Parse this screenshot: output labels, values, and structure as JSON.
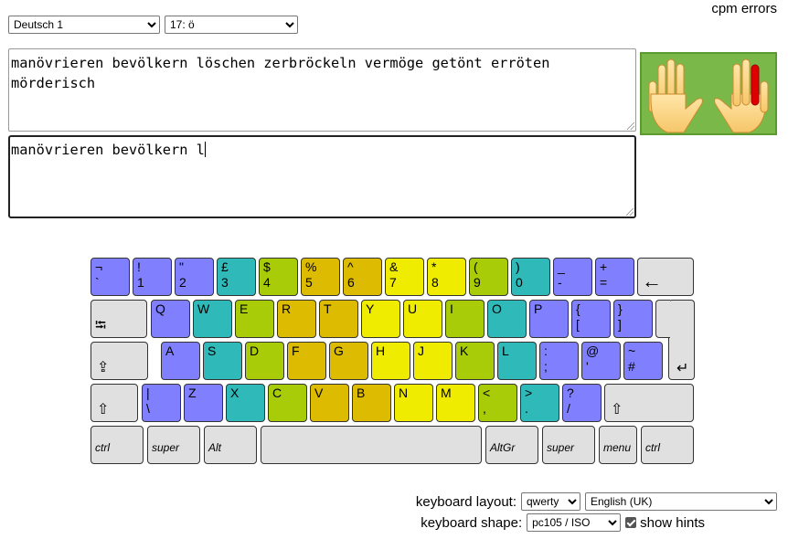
{
  "lesson": {
    "selected": "Deutsch 1"
  },
  "level": {
    "selected": "17: ö"
  },
  "stats": {
    "text": "cpm errors"
  },
  "source_text": "manövrieren bevölkern löschen zerbröckeln vermöge getönt erröten mörderisch",
  "typed_text": "manövrieren bevölkern l",
  "colors": {
    "pinky": "#8080ff",
    "ring": "#30b9b9",
    "middle": "#a8cc08",
    "index_left": "#ddbb00",
    "index_right": "#f0ec00",
    "thumb": "#e0e0e0",
    "hands_bg": "#7bb84a",
    "highlight_finger": "#e00000"
  },
  "keyboard": {
    "row1": [
      {
        "top": "¬",
        "bottom": "`",
        "color": "pinky"
      },
      {
        "top": "!",
        "bottom": "1",
        "color": "pinky"
      },
      {
        "top": "\"",
        "bottom": "2",
        "color": "pinky"
      },
      {
        "top": "£",
        "bottom": "3",
        "color": "ring"
      },
      {
        "top": "$",
        "bottom": "4",
        "color": "middle"
      },
      {
        "top": "%",
        "bottom": "5",
        "color": "index_left"
      },
      {
        "top": "^",
        "bottom": "6",
        "color": "index_left"
      },
      {
        "top": "&",
        "bottom": "7",
        "color": "index_right"
      },
      {
        "top": "*",
        "bottom": "8",
        "color": "index_right"
      },
      {
        "top": "(",
        "bottom": "9",
        "color": "middle"
      },
      {
        "top": ")",
        "bottom": "0",
        "color": "ring"
      },
      {
        "top": "_",
        "bottom": "-",
        "color": "pinky"
      },
      {
        "top": "+",
        "bottom": "=",
        "color": "pinky"
      },
      {
        "symbol": "←",
        "name": "backspace",
        "color": "thumb"
      }
    ],
    "row2": [
      {
        "symbol": "⭾",
        "name": "tab",
        "color": "thumb"
      },
      {
        "top": "Q",
        "color": "pinky"
      },
      {
        "top": "W",
        "color": "ring"
      },
      {
        "top": "E",
        "color": "middle"
      },
      {
        "top": "R",
        "color": "index_left"
      },
      {
        "top": "T",
        "color": "index_left"
      },
      {
        "top": "Y",
        "color": "index_right"
      },
      {
        "top": "U",
        "color": "index_right"
      },
      {
        "top": "I",
        "color": "middle"
      },
      {
        "top": "O",
        "color": "ring"
      },
      {
        "top": "P",
        "color": "pinky"
      },
      {
        "top": "{",
        "bottom": "[",
        "color": "pinky"
      },
      {
        "top": "}",
        "bottom": "]",
        "color": "pinky"
      }
    ],
    "row3": [
      {
        "symbol": "⇪",
        "name": "caps-lock",
        "color": "thumb"
      },
      {
        "top": "A",
        "color": "pinky"
      },
      {
        "top": "S",
        "color": "ring"
      },
      {
        "top": "D",
        "color": "middle"
      },
      {
        "top": "F",
        "color": "index_left"
      },
      {
        "top": "G",
        "color": "index_left"
      },
      {
        "top": "H",
        "color": "index_right"
      },
      {
        "top": "J",
        "color": "index_right"
      },
      {
        "top": "K",
        "color": "middle"
      },
      {
        "top": "L",
        "color": "ring"
      },
      {
        "top": ":",
        "bottom": ";",
        "color": "pinky"
      },
      {
        "top": "@",
        "bottom": "'",
        "color": "pinky"
      },
      {
        "top": "~",
        "bottom": "#",
        "color": "pinky"
      },
      {
        "symbol": "↵",
        "name": "enter",
        "color": "thumb"
      }
    ],
    "row4": [
      {
        "symbol": "⇧",
        "name": "left-shift",
        "color": "thumb"
      },
      {
        "top": "|",
        "bottom": "\\",
        "color": "pinky"
      },
      {
        "top": "Z",
        "color": "pinky"
      },
      {
        "top": "X",
        "color": "ring"
      },
      {
        "top": "C",
        "color": "middle"
      },
      {
        "top": "V",
        "color": "index_left"
      },
      {
        "top": "B",
        "color": "index_left"
      },
      {
        "top": "N",
        "color": "index_right"
      },
      {
        "top": "M",
        "color": "index_right"
      },
      {
        "top": "<",
        "bottom": ",",
        "color": "middle"
      },
      {
        "top": ">",
        "bottom": ".",
        "color": "ring"
      },
      {
        "top": "?",
        "bottom": "/",
        "color": "pinky"
      },
      {
        "symbol": "⇧",
        "name": "right-shift",
        "color": "thumb"
      }
    ],
    "row5": [
      {
        "label": "ctrl",
        "color": "thumb"
      },
      {
        "label": "super",
        "color": "thumb"
      },
      {
        "label": "Alt",
        "color": "thumb"
      },
      {
        "label": "",
        "name": "space",
        "color": "thumb"
      },
      {
        "label": "AltGr",
        "color": "thumb"
      },
      {
        "label": "super",
        "color": "thumb"
      },
      {
        "label": "menu",
        "color": "thumb"
      },
      {
        "label": "ctrl",
        "color": "thumb"
      }
    ]
  },
  "settings": {
    "layout_label": "keyboard layout:",
    "layout_selected": "qwerty",
    "language_selected": "English (UK)",
    "shape_label": "keyboard shape:",
    "shape_selected": "pc105 / ISO",
    "show_hints_label": "show hints",
    "show_hints_checked": true
  }
}
